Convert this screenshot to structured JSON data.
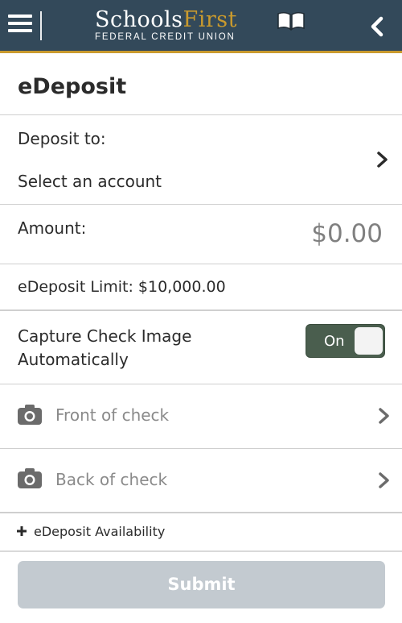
{
  "header": {
    "logo": {
      "word_a": "Schools",
      "word_b": "First",
      "subtitle": "FEDERAL CREDIT UNION"
    },
    "menu_icon": "hamburger-icon",
    "back_icon": "chevron-left-icon",
    "colors": {
      "bar": "#33495a",
      "accent": "#c99a2e"
    }
  },
  "page": {
    "title": "eDeposit"
  },
  "deposit_to": {
    "label": "Deposit to:",
    "value": "Select an account"
  },
  "amount": {
    "label": "Amount:",
    "value": "$0.00"
  },
  "limit": {
    "text": "eDeposit Limit: $10,000.00"
  },
  "capture": {
    "label_line1": "Capture Check Image",
    "label_line2": "Automatically",
    "toggle_label": "On",
    "enabled": true
  },
  "front_check": {
    "label": "Front of check",
    "icon": "camera-icon"
  },
  "back_check": {
    "label": "Back of check",
    "icon": "camera-icon"
  },
  "availability": {
    "label": "eDeposit Availability",
    "icon": "plus-icon"
  },
  "submit": {
    "label": "Submit"
  }
}
